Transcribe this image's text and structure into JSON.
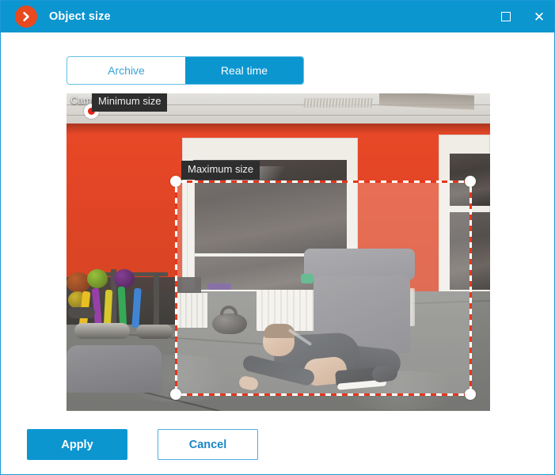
{
  "window": {
    "title": "Object size",
    "logo_icon": "chevron-right-circle-icon",
    "logo_color": "#e8491f",
    "titlebar_color": "#0b96d0",
    "controls": {
      "maximize_label": "",
      "maximize_icon": "maximize-square-icon",
      "close_label": "✕",
      "close_icon": "close-x-icon"
    }
  },
  "tabs": {
    "items": [
      {
        "label": "Archive",
        "active": false
      },
      {
        "label": "Real time",
        "active": true
      }
    ],
    "active_color": "#0b96d0",
    "inactive_text_color": "#3ba3d6"
  },
  "video": {
    "camera_label": "Camera 1",
    "min_size_tooltip": "Minimum size",
    "max_size_tooltip": "Maximum size",
    "min_marker_icon": "minimum-size-marker-icon",
    "selection_border_color": "#e8361a",
    "handle_color": "#ffffff"
  },
  "footer": {
    "apply_label": "Apply",
    "cancel_label": "Cancel",
    "apply_color": "#0b96d0",
    "cancel_border_color": "#4aade0"
  }
}
